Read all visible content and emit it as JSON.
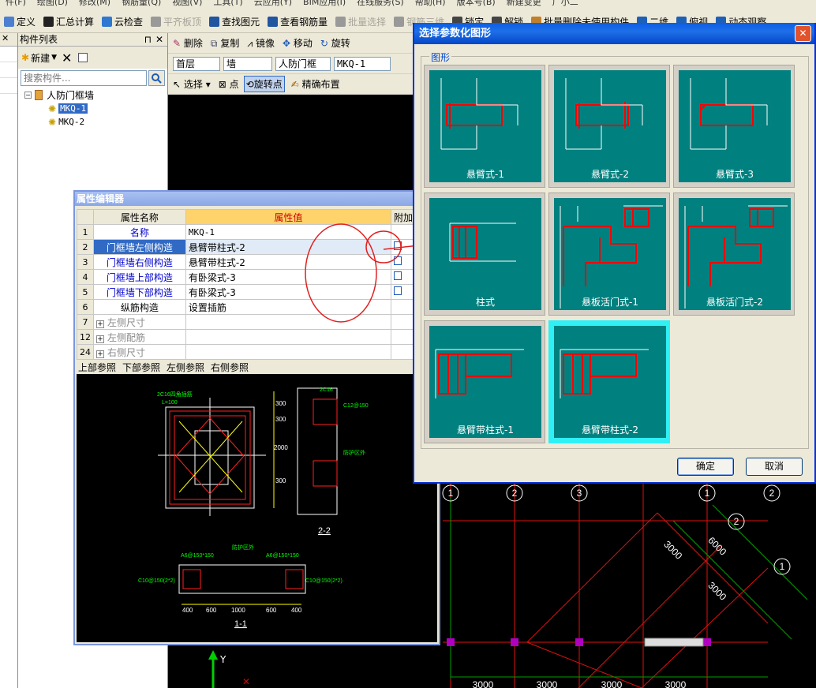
{
  "menubar": [
    "件(F)",
    "绘图(D)",
    "修改(M)",
    "钢筋量(Q)",
    "视图(V)",
    "工具(T)",
    "云应用(Y)",
    "BIM应用(I)",
    "在线服务(S)",
    "帮助(H)",
    "版本号(B)",
    "新建变更",
    "广小二"
  ],
  "toolbar1": [
    {
      "label": "定义",
      "disabled": false
    },
    {
      "label": "汇总计算",
      "disabled": false
    },
    {
      "label": "云检查",
      "disabled": false
    },
    {
      "label": "平齐板顶",
      "disabled": true
    },
    {
      "label": "查找图元",
      "disabled": false
    },
    {
      "label": "查看钢筋量",
      "disabled": false
    },
    {
      "label": "批量选择",
      "disabled": true
    },
    {
      "label": "钢筋三维",
      "disabled": true
    },
    {
      "label": "锁定",
      "disabled": false
    },
    {
      "label": "解锁",
      "disabled": false
    },
    {
      "label": "批量删除未使用构件",
      "disabled": false
    },
    {
      "label": "二维",
      "disabled": false
    },
    {
      "label": "俯视",
      "disabled": false
    },
    {
      "label": "动态观察",
      "disabled": false
    }
  ],
  "component_panel": {
    "title": "构件列表",
    "new_label": "新建",
    "search_placeholder": "搜索构件...",
    "tree_root": "人防门框墙",
    "tree_items": [
      "MKQ-1",
      "MKQ-2"
    ]
  },
  "main_toolbar": {
    "delete": "删除",
    "copy": "复制",
    "mirror": "镜像",
    "move": "移动",
    "rotate": "旋转",
    "floor": "首层",
    "category": "墙",
    "type": "人防门框",
    "component": "MKQ-1",
    "select": "选择",
    "point": "点",
    "rotate_point": "旋转点",
    "precise_place": "精确布置"
  },
  "property_editor": {
    "title": "属性编辑器",
    "col_name": "属性名称",
    "col_value": "属性值",
    "col_extra": "附加",
    "rows": [
      {
        "num": "1",
        "name": "名称",
        "value": "MKQ-1",
        "style": "blue"
      },
      {
        "num": "2",
        "name": "门框墙左侧构造",
        "value": "悬臂带柱式-2",
        "style": "blue"
      },
      {
        "num": "3",
        "name": "门框墙右侧构造",
        "value": "悬臂带柱式-2",
        "style": "blue"
      },
      {
        "num": "4",
        "name": "门框墙上部构造",
        "value": "有卧梁式-3",
        "style": "blue"
      },
      {
        "num": "5",
        "name": "门框墙下部构造",
        "value": "有卧梁式-3",
        "style": "blue"
      },
      {
        "num": "6",
        "name": "纵筋构造",
        "value": "设置插筋",
        "style": "black"
      },
      {
        "num": "7",
        "name": "左侧尺寸",
        "value": "",
        "style": "gray"
      },
      {
        "num": "12",
        "name": "左侧配筋",
        "value": "",
        "style": "gray"
      },
      {
        "num": "24",
        "name": "右侧尺寸",
        "value": "",
        "style": "gray"
      }
    ],
    "tabs": [
      "上部参照",
      "下部参照",
      "左侧参照",
      "右侧参照"
    ],
    "drawing_labels": {
      "top_sec": "2C16四角插筋",
      "l": "L=100",
      "sec22": "2-2",
      "sec11": "1-1",
      "guard": "防护区外",
      "a6": "A6@150*150",
      "c10": "C10@150(2*2)",
      "d400": "400",
      "d600": "600",
      "d1000": "1000",
      "d300": "300",
      "d2000": "2000",
      "c16": "2C16",
      "c12": "C12@150"
    }
  },
  "dialog": {
    "title": "选择参数化图形",
    "group_label": "图形",
    "shapes": [
      "悬臂式-1",
      "悬臂式-2",
      "悬臂式-3",
      "柱式",
      "悬板活门式-1",
      "悬板活门式-2",
      "悬臂带柱式-1",
      "悬臂带柱式-2"
    ],
    "selected": "悬臂带柱式-2",
    "ok": "确定",
    "cancel": "取消"
  },
  "canvas": {
    "axis_labels": [
      "1",
      "2",
      "3",
      "1",
      "2",
      "2",
      "1"
    ],
    "dims": [
      "3000",
      "6000",
      "3000",
      "3000",
      "3000",
      "3000",
      "3000"
    ],
    "y_axis": "Y"
  },
  "colors": {
    "teal": "#00807f",
    "red": "#ff0000",
    "selected_card": "#2ef0f5",
    "title_blue": "#0a5ee4",
    "grid_red": "#e01010"
  }
}
